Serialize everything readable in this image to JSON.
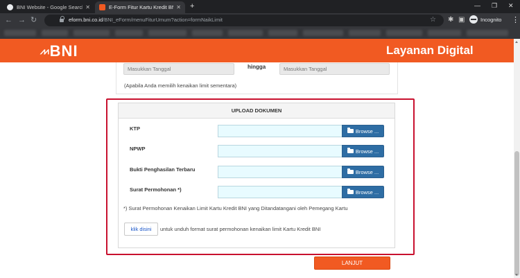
{
  "browser": {
    "tabs": [
      {
        "title": "BNI Website - Google Search",
        "active": false
      },
      {
        "title": "E-Form Fitur Kartu Kredit BNI",
        "active": true
      }
    ],
    "url_host": "eform.bni.co.id",
    "url_path": "/BNI_eForm/menuFiturUmum?action=formNaikLimit",
    "incognito_label": "Incognito"
  },
  "header": {
    "logo_text": "BNI",
    "title": "Layanan Digital"
  },
  "date_range": {
    "from_placeholder": "Masukkan Tanggal",
    "to_placeholder": "Masukkan Tanggal",
    "separator": "hingga",
    "note": "(Apabila Anda memilih kenaikan limit sementara)"
  },
  "upload": {
    "heading": "UPLOAD DOKUMEN",
    "rows": [
      {
        "label": "KTP",
        "browse_label": "Browse ..."
      },
      {
        "label": "NPWP",
        "browse_label": "Browse ..."
      },
      {
        "label": "Bukti Penghasilan Terbaru",
        "browse_label": "Browse ..."
      },
      {
        "label": "Surat Permohonan *)",
        "browse_label": "Browse ..."
      }
    ],
    "footnote": "*) Surat Permohonan Kenaikan Limit Kartu Kredit BNI yang Ditandatangani oleh Pemegang Kartu",
    "download_button": "klik disini",
    "download_note": "untuk unduh format surat permohonan kenaikan limit Kartu Kredit BNI"
  },
  "submit_label": "LANJUT",
  "colors": {
    "brand_orange": "#f15a22",
    "browse_blue": "#2e6da4",
    "highlight_red": "#c8102e"
  }
}
